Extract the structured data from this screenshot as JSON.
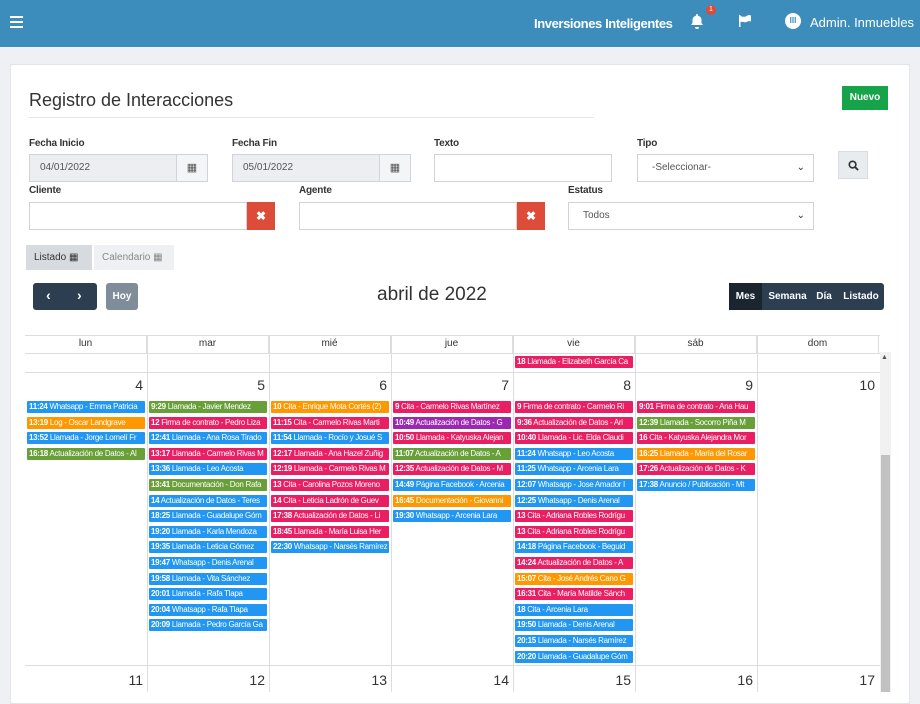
{
  "header": {
    "brand": "Inversiones Inteligentes",
    "notifications": "1",
    "user": "Admin. Inmuebles",
    "avatar": "III"
  },
  "page": {
    "title": "Registro de Interacciones",
    "new_button": "Nuevo"
  },
  "filters": {
    "fecha_inicio_label": "Fecha Inicio",
    "fecha_inicio": "04/01/2022",
    "fecha_fin_label": "Fecha Fin",
    "fecha_fin": "05/01/2022",
    "texto_label": "Texto",
    "texto": "",
    "tipo_label": "Tipo",
    "tipo": "-Seleccionar-",
    "cliente_label": "Cliente",
    "cliente": "",
    "agente_label": "Agente",
    "agente": "",
    "estatus_label": "Estatus",
    "estatus": "Todos"
  },
  "tabs": {
    "listado": "Listado",
    "calendario": "Calendario"
  },
  "calendar": {
    "title": "abril de 2022",
    "today": "Hoy",
    "views": [
      "Mes",
      "Semana",
      "Día",
      "Listado"
    ],
    "days": [
      "lun",
      "mar",
      "mié",
      "jue",
      "vie",
      "sáb",
      "dom"
    ],
    "week1_numbers": [
      "4",
      "5",
      "6",
      "7",
      "8",
      "9",
      "10"
    ],
    "week2_numbers": [
      "11",
      "12",
      "13",
      "14",
      "15",
      "16",
      "17"
    ]
  },
  "colors": {
    "whatsapp": "#2196f3",
    "llamada": "#e91e63",
    "cita": "#e91e63",
    "actualizacion": "#4caf50",
    "log": "#ff9800",
    "documentacion": "#4caf50",
    "firma": "#e91e63",
    "pagina": "#00bcd4",
    "anuncio": "#2196f3",
    "prev": "#e91e63"
  },
  "prev_event": {
    "time": "18",
    "text": " Llamada - Elizabeth García Ca"
  },
  "events": {
    "lun": [
      {
        "t": "11:24",
        "x": " Whatsapp - Emma Patricia",
        "c": "#2196f3"
      },
      {
        "t": "13:19",
        "x": " Log - Oscar Landgrave",
        "c": "#ff9800"
      },
      {
        "t": "13:52",
        "x": " Llamada - Jorge Lomelí Fr",
        "c": "#2196f3"
      },
      {
        "t": "16:18",
        "x": " Actualización de Datos - Al",
        "c": "#689f38"
      }
    ],
    "mar": [
      {
        "t": "9:29",
        "x": " Llamada - Javier Mendez",
        "c": "#689f38"
      },
      {
        "t": "12",
        "x": " Firma de contrato - Pedro Liza",
        "c": "#e91e63"
      },
      {
        "t": "12:41",
        "x": " Llamada - Ana Rosa Tirado",
        "c": "#2196f3"
      },
      {
        "t": "13:17",
        "x": " Llamada - Carmelo Rivas M",
        "c": "#e91e63"
      },
      {
        "t": "13:36",
        "x": " Llamada - Leo Acosta",
        "c": "#2196f3"
      },
      {
        "t": "13:41",
        "x": " Documentación - Don Rafa",
        "c": "#689f38"
      },
      {
        "t": "14",
        "x": " Actualización de Datos - Teres",
        "c": "#2196f3"
      },
      {
        "t": "18:25",
        "x": " Llamada - Guadalupe Góm",
        "c": "#2196f3"
      },
      {
        "t": "19:20",
        "x": " Llamada - Karla Mendoza",
        "c": "#2196f3"
      },
      {
        "t": "19:35",
        "x": " Llamada - Leticia Gómez",
        "c": "#2196f3"
      },
      {
        "t": "19:47",
        "x": " Whatsapp - Denis Arenal",
        "c": "#2196f3"
      },
      {
        "t": "19:58",
        "x": " Llamada - Vita Sánchez",
        "c": "#2196f3"
      },
      {
        "t": "20:01",
        "x": " Llamada - Rafa Tlapa",
        "c": "#2196f3"
      },
      {
        "t": "20:04",
        "x": " Whatsapp - Rafa Tlapa",
        "c": "#2196f3"
      },
      {
        "t": "20:09",
        "x": " Llamada - Pedro García Ga",
        "c": "#2196f3"
      }
    ],
    "mie": [
      {
        "t": "10",
        "x": " Cita - Enrique Mota Cortés (2)",
        "c": "#ff9800"
      },
      {
        "t": "11:15",
        "x": " Cita - Carmelo Rivas Marti",
        "c": "#e91e63"
      },
      {
        "t": "11:54",
        "x": " Llamada - Rocío y Josué S",
        "c": "#2196f3"
      },
      {
        "t": "12:17",
        "x": " Llamada - Ana Hazel Zuñig",
        "c": "#e91e63"
      },
      {
        "t": "12:19",
        "x": " Llamada - Carmelo Rivas M",
        "c": "#e91e63"
      },
      {
        "t": "13",
        "x": " Cita - Carolina Pozos Moreno",
        "c": "#e91e63"
      },
      {
        "t": "14",
        "x": " Cita - Leticia Ladrón de Guev",
        "c": "#e91e63"
      },
      {
        "t": "17:38",
        "x": " Actualización de Datos - Li",
        "c": "#e91e63"
      },
      {
        "t": "18:45",
        "x": " Llamada - María Luisa Her",
        "c": "#e91e63"
      },
      {
        "t": "22:30",
        "x": " Whatsapp - Narsés Ramírez",
        "c": "#2196f3"
      }
    ],
    "jue": [
      {
        "t": "9",
        "x": " Cita - Carmelo Rivas Martínez",
        "c": "#e91e63"
      },
      {
        "t": "10:49",
        "x": " Actualización de Datos - G",
        "c": "#9c27b0"
      },
      {
        "t": "10:50",
        "x": " Llamada - Katyuska Alejan",
        "c": "#e91e63"
      },
      {
        "t": "11:07",
        "x": " Actualización de Datos - A",
        "c": "#689f38"
      },
      {
        "t": "12:35",
        "x": " Actualización de Datos - M",
        "c": "#e91e63"
      },
      {
        "t": "14:49",
        "x": " Página Facebook - Arcenia",
        "c": "#2196f3"
      },
      {
        "t": "16:45",
        "x": " Documentación - Giovanni",
        "c": "#ff9800"
      },
      {
        "t": "19:30",
        "x": " Whatsapp - Arcenia Lara",
        "c": "#2196f3"
      }
    ],
    "vie": [
      {
        "t": "9",
        "x": " Firma de contrato - Carmelo Ri",
        "c": "#e91e63"
      },
      {
        "t": "9:36",
        "x": " Actualización de Datos - Ari",
        "c": "#e91e63"
      },
      {
        "t": "10:40",
        "x": " Llamada - Lic. Elda Claudi",
        "c": "#e91e63"
      },
      {
        "t": "11:24",
        "x": " Whatsapp - Leo Acosta",
        "c": "#2196f3"
      },
      {
        "t": "11:25",
        "x": " Whatsapp - Arcenia Lara",
        "c": "#2196f3"
      },
      {
        "t": "12:07",
        "x": " Whatsapp - Jose Amador I",
        "c": "#2196f3"
      },
      {
        "t": "12:25",
        "x": " Whatsapp - Denis Arenal",
        "c": "#2196f3"
      },
      {
        "t": "13",
        "x": " Cita - Adriana Robles Rodrígu",
        "c": "#e91e63"
      },
      {
        "t": "13",
        "x": " Cita - Adriana Robles Rodrígu",
        "c": "#e91e63"
      },
      {
        "t": "14:18",
        "x": " Página Facebook - Beguid",
        "c": "#2196f3"
      },
      {
        "t": "14:24",
        "x": " Actualización de Datos - A",
        "c": "#e91e63"
      },
      {
        "t": "15:07",
        "x": " Cita - José Andrés Cano G",
        "c": "#ff9800"
      },
      {
        "t": "16:31",
        "x": " Cita - María Matilde Sánch",
        "c": "#e91e63"
      },
      {
        "t": "18",
        "x": " Cita - Arcenia Lara",
        "c": "#2196f3"
      },
      {
        "t": "19:50",
        "x": " Llamada - Denis Arenal",
        "c": "#2196f3"
      },
      {
        "t": "20:15",
        "x": " Llamada - Narsés Ramírez",
        "c": "#2196f3"
      },
      {
        "t": "20:20",
        "x": " Llamada - Guadalupe Góm",
        "c": "#2196f3"
      }
    ],
    "sab": [
      {
        "t": "9:01",
        "x": " Firma de contrato - Ana Hau",
        "c": "#e91e63"
      },
      {
        "t": "12:39",
        "x": " Llamada - Socorro Piña M",
        "c": "#689f38"
      },
      {
        "t": "16",
        "x": " Cita - Katyuska Alejandra Mor",
        "c": "#e91e63"
      },
      {
        "t": "16:25",
        "x": " Llamada - María del Rosar",
        "c": "#ff9800"
      },
      {
        "t": "17:26",
        "x": " Actualización de Datos - K",
        "c": "#e91e63"
      },
      {
        "t": "17:38",
        "x": " Anuncio / Publicación - Mt",
        "c": "#2196f3"
      }
    ]
  }
}
